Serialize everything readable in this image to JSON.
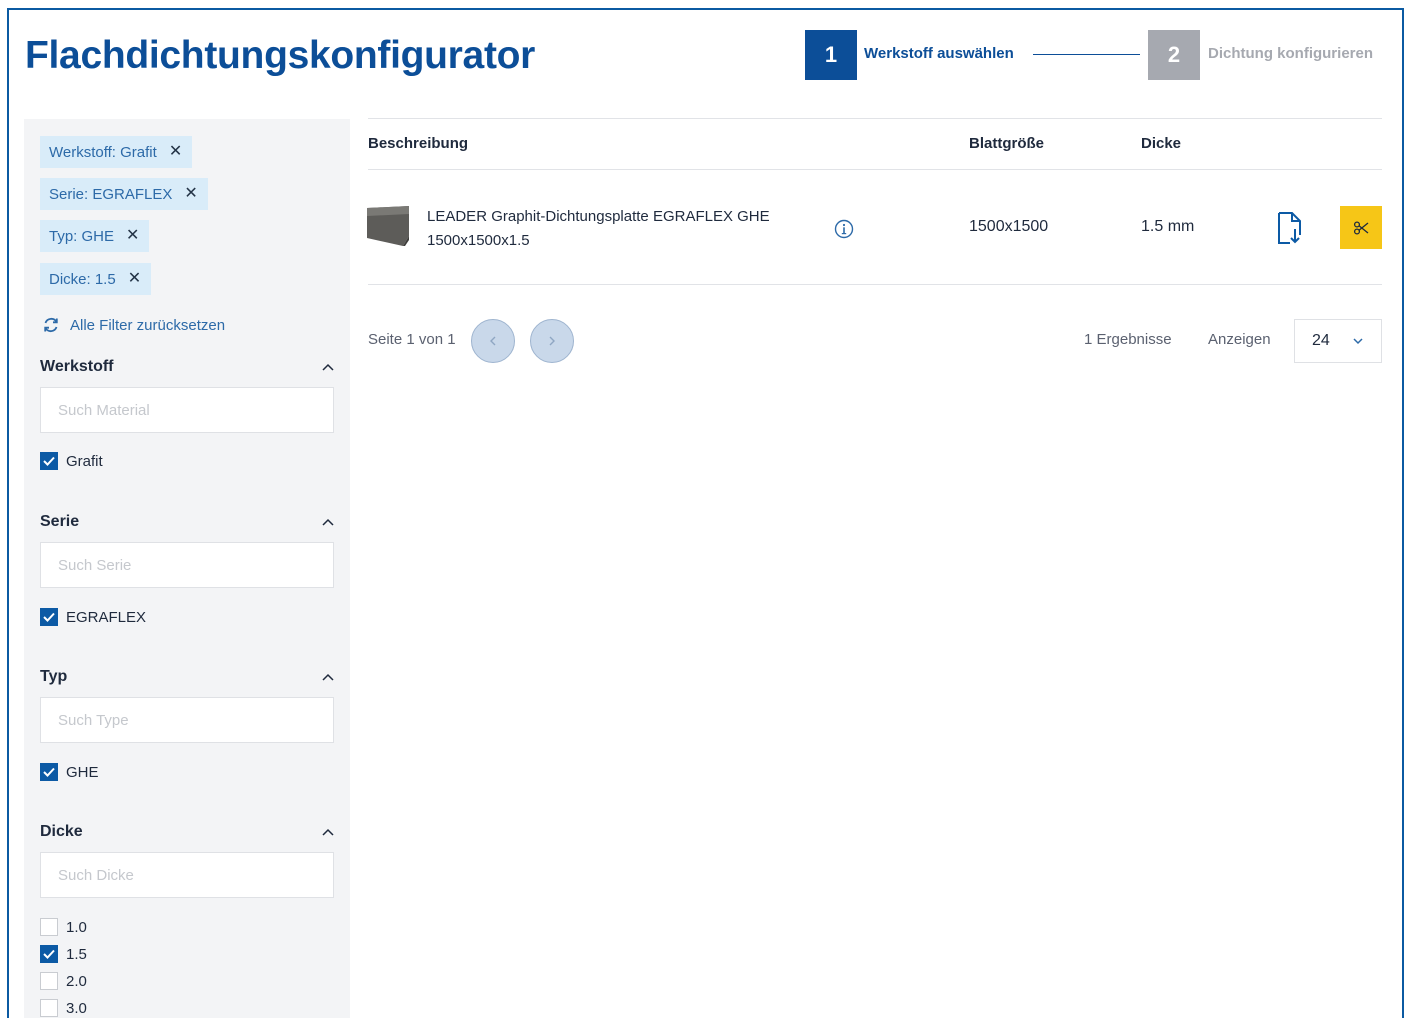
{
  "header": {
    "title": "Flachdichtungskonfigurator",
    "steps": [
      {
        "number": "1",
        "label": "Werkstoff auswählen",
        "state": "active"
      },
      {
        "number": "2",
        "label": "Dichtung konfigurieren",
        "state": "inactive"
      }
    ]
  },
  "filters": {
    "chips": [
      {
        "label": "Werkstoff: Grafit"
      },
      {
        "label": "Serie: EGRAFLEX"
      },
      {
        "label": "Typ: GHE"
      },
      {
        "label": "Dicke: 1.5"
      }
    ],
    "reset_label": "Alle Filter zurücksetzen",
    "sections": {
      "werkstoff": {
        "title": "Werkstoff",
        "placeholder": "Such Material",
        "options": [
          {
            "label": "Grafit",
            "checked": true
          }
        ]
      },
      "serie": {
        "title": "Serie",
        "placeholder": "Such Serie",
        "options": [
          {
            "label": "EGRAFLEX",
            "checked": true
          }
        ]
      },
      "typ": {
        "title": "Typ",
        "placeholder": "Such Type",
        "options": [
          {
            "label": "GHE",
            "checked": true
          }
        ]
      },
      "dicke": {
        "title": "Dicke",
        "placeholder": "Such Dicke",
        "options": [
          {
            "label": "1.0",
            "checked": false
          },
          {
            "label": "1.5",
            "checked": true
          },
          {
            "label": "2.0",
            "checked": false
          },
          {
            "label": "3.0",
            "checked": false
          }
        ]
      }
    }
  },
  "table": {
    "columns": {
      "description": "Beschreibung",
      "sheet_size": "Blattgröße",
      "thickness": "Dicke"
    },
    "rows": [
      {
        "description_line1": "LEADER Graphit-Dichtungsplatte EGRAFLEX GHE",
        "description_line2": "1500x1500x1.5",
        "sheet_size": "1500x1500",
        "thickness": "1.5 mm"
      }
    ]
  },
  "pagination": {
    "page_text": "Seite 1 von 1",
    "results_text": "1 Ergebnisse",
    "show_label": "Anzeigen",
    "per_page": "24"
  },
  "colors": {
    "brand_blue": "#0c4e98",
    "accent_yellow": "#f6c617",
    "chip_bg": "#d9ecf9",
    "step_inactive": "#a6a9b0"
  }
}
